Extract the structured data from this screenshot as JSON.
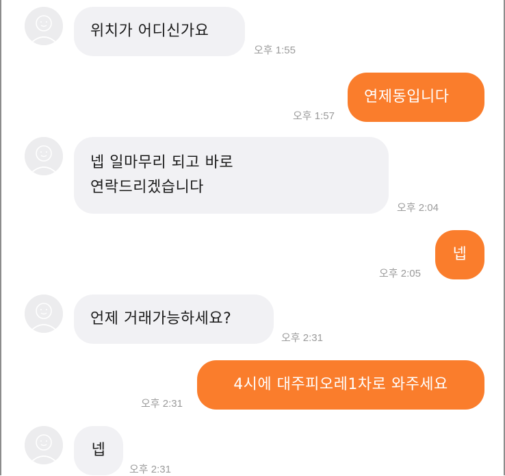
{
  "messages": [
    {
      "id": "m1",
      "direction": "incoming",
      "text": "위치가 어디신가요",
      "time": "오후 1:55"
    },
    {
      "id": "m2",
      "direction": "outgoing",
      "text": "연제동입니다",
      "time": "오후 1:57"
    },
    {
      "id": "m3",
      "direction": "incoming",
      "lines": [
        "넵 일마무리 되고 바로",
        "연락드리겠습니다"
      ],
      "time": "오후 2:04"
    },
    {
      "id": "m4",
      "direction": "outgoing",
      "text": "넵",
      "time": "오후 2:05"
    },
    {
      "id": "m5",
      "direction": "incoming",
      "text": "언제 거래가능하세요?",
      "time": "오후 2:31"
    },
    {
      "id": "m6",
      "direction": "outgoing",
      "text": "4시에 대주피오레1차로 와주세요",
      "time": "오후 2:31"
    },
    {
      "id": "m7",
      "direction": "incoming",
      "text": "넵",
      "time": "오후 2:31"
    }
  ],
  "colors": {
    "outgoing_bubble": "#fa7d2c",
    "incoming_bubble": "#f1f1f4",
    "timestamp": "#9a9a9a"
  },
  "icons": {
    "avatar": "default-profile-icon"
  }
}
